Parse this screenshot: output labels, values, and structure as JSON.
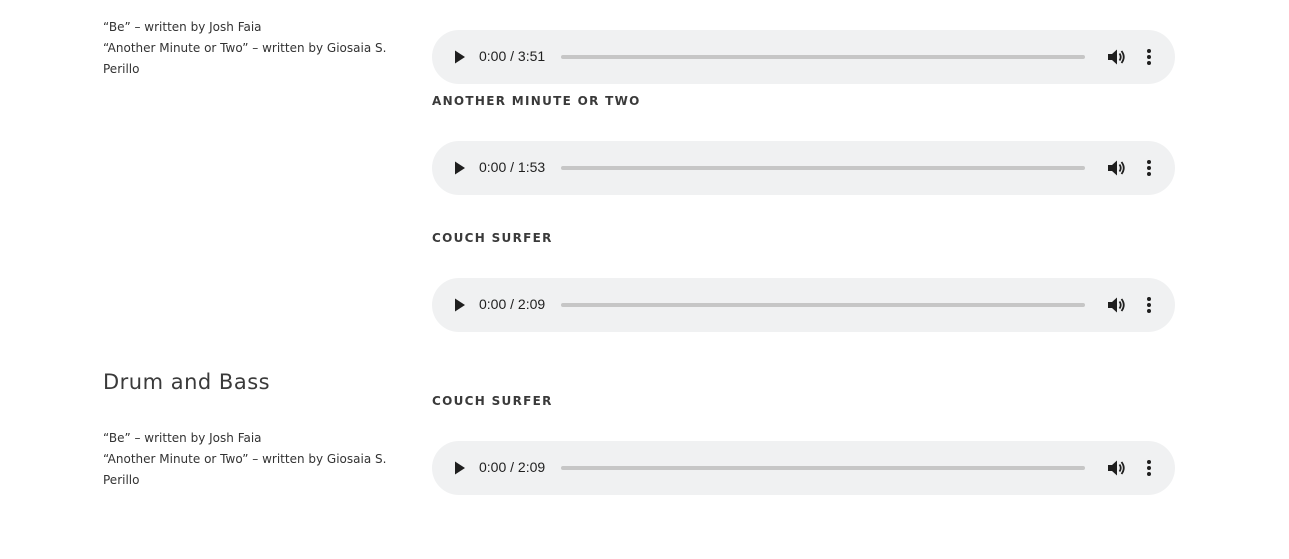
{
  "groups": [
    {
      "heading": "",
      "credits": [
        "“Be” – written by Josh Faia",
        "“Another Minute or Two” – written by Giosaia S. Perillo"
      ]
    },
    {
      "heading": "Drum and Bass",
      "credits": [
        "“Be” – written by Josh Faia",
        "“Another Minute or Two” – written by Giosaia S. Perillo"
      ]
    }
  ],
  "tracks": [
    {
      "title": "",
      "current_time": "0:00",
      "separator": " / ",
      "duration": "3:51",
      "progress": 0
    },
    {
      "title": "ANOTHER MINUTE OR TWO",
      "current_time": "0:00",
      "separator": " / ",
      "duration": "1:53",
      "progress": 0
    },
    {
      "title": "COUCH SURFER",
      "current_time": "0:00",
      "separator": " / ",
      "duration": "2:09",
      "progress": 0
    },
    {
      "title": "COUCH SURFER",
      "current_time": "0:00",
      "separator": " / ",
      "duration": "2:09",
      "progress": 0
    }
  ],
  "icons": {
    "play": "play-icon",
    "volume": "volume-icon",
    "more": "more-vertical-icon"
  },
  "colors": {
    "player_background": "#f0f1f2",
    "progress_track": "#c6c6c6",
    "text": "#333333"
  }
}
